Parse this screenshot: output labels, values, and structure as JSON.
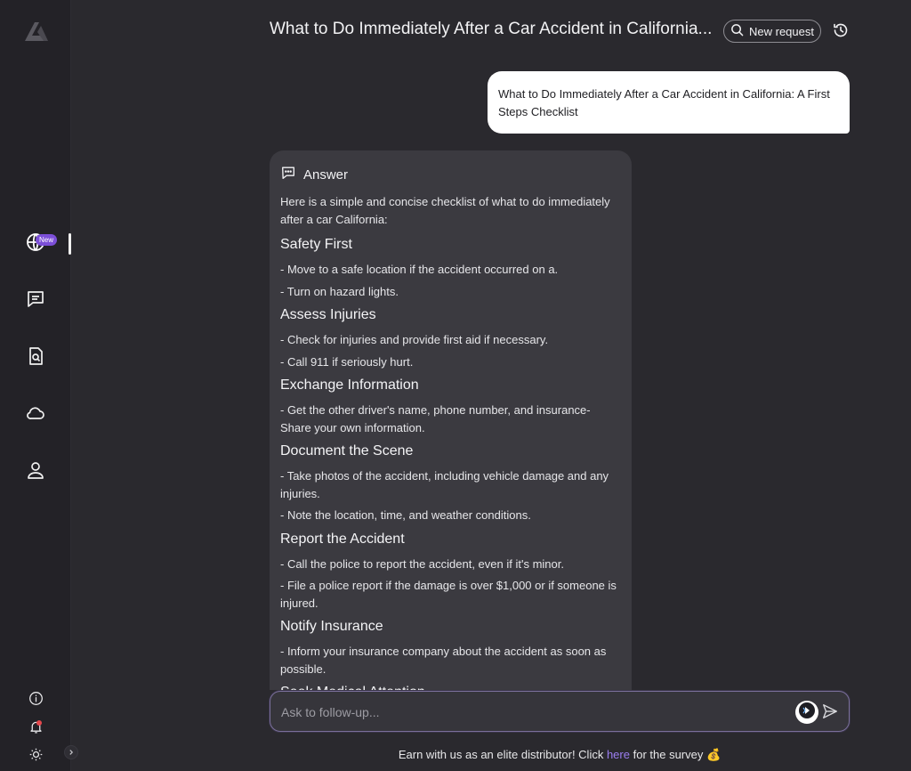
{
  "header": {
    "title": "What to Do Immediately After a Car Accident in California...",
    "new_request_label": "New request"
  },
  "sidebar": {
    "items": [
      {
        "icon": "globe-icon",
        "badge": "New"
      },
      {
        "icon": "chat-icon"
      },
      {
        "icon": "document-search-icon"
      },
      {
        "icon": "cloud-icon"
      },
      {
        "icon": "user-icon"
      }
    ],
    "bottom": [
      "info-icon",
      "bell-icon",
      "sun-icon"
    ]
  },
  "user_message": "What to Do Immediately After a Car Accident in California: A First Steps Checklist",
  "answer": {
    "label": "Answer",
    "intro": "Here is a simple and concise checklist of what to do immediately after a car California:",
    "sections": [
      {
        "heading": "Safety First",
        "items": [
          "- Move to a safe location if the accident occurred on a.",
          "- Turn on hazard lights."
        ]
      },
      {
        "heading": "Assess Injuries",
        "items": [
          "- Check for injuries and provide first aid if necessary.",
          "- Call 911 if seriously hurt."
        ]
      },
      {
        "heading": "Exchange Information",
        "items": [
          "- Get the other driver's name, phone number, and insurance- Share your own information."
        ]
      },
      {
        "heading": "Document the Scene",
        "items": [
          "- Take photos of the accident, including vehicle damage and any injuries.",
          "- Note the location, time, and weather conditions."
        ]
      },
      {
        "heading": "Report the Accident",
        "items": [
          "- Call the police to report the accident, even if it's minor.",
          "- File a police report if the damage is over $1,000 or if someone is injured."
        ]
      },
      {
        "heading": "Notify Insurance",
        "items": [
          "- Inform your insurance company about the accident as soon as possible."
        ]
      },
      {
        "heading": "Seek Medical Attention",
        "items": []
      }
    ]
  },
  "input": {
    "placeholder": "Ask to follow-up..."
  },
  "footer": {
    "text_before": "Earn with us as an elite distributor! Click ",
    "link": "here",
    "text_after": " for the survey 💰"
  },
  "colors": {
    "accent": "#7c4fd8",
    "link": "#9b7ef0",
    "background": "#2a292e"
  }
}
